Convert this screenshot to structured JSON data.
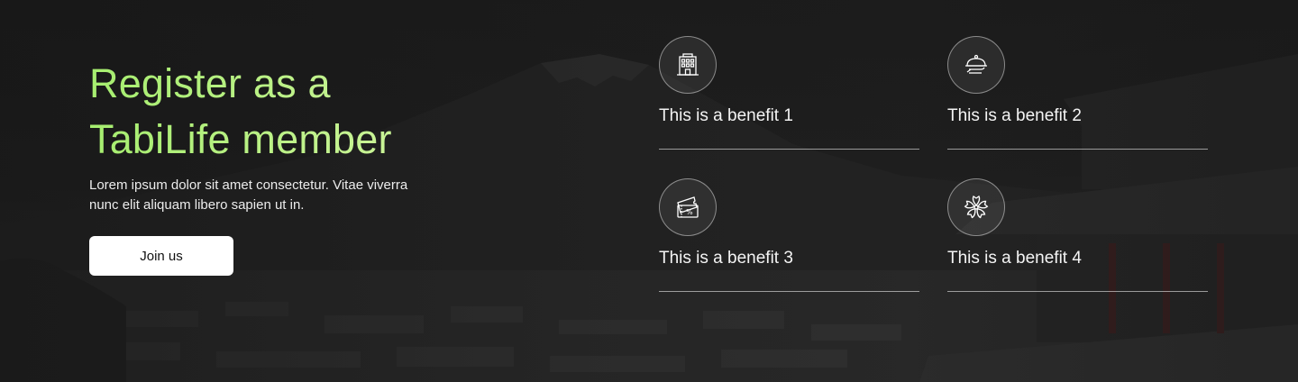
{
  "hero": {
    "title_line1": "Register as a",
    "title_line2": "TabiLife member",
    "description": "Lorem ipsum dolor sit amet consectetur. Vitae viverra nunc elit aliquam libero sapien ut in.",
    "join_label": "Join us"
  },
  "benefits": [
    {
      "label": "This is a benefit 1",
      "icon": "building-icon"
    },
    {
      "label": "This is a benefit 2",
      "icon": "food-cloche-icon"
    },
    {
      "label": "This is a benefit 3",
      "icon": "discount-ticket-icon"
    },
    {
      "label": "This is a benefit 4",
      "icon": "sakura-flower-icon"
    }
  ],
  "colors": {
    "title_gradient_start": "#a6ee6f",
    "title_gradient_end": "#d2f5a0",
    "background": "#1b1b1b",
    "button_bg": "#ffffff"
  }
}
